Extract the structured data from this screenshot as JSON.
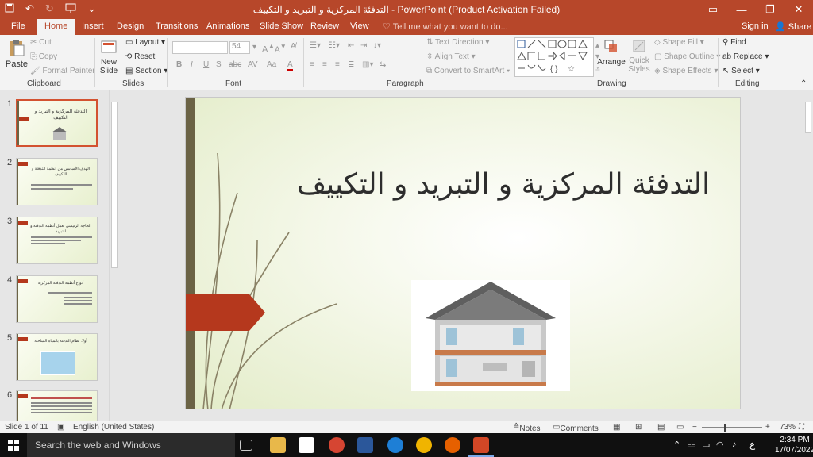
{
  "titlebar": {
    "title": "التدفئة المركزية و التبريد و التكييف - PowerPoint (Product Activation Failed)",
    "qat_icons": [
      "save-icon",
      "undo-icon",
      "redo-icon",
      "present-icon",
      "customize-icon"
    ],
    "restore_icon": "▭",
    "minimize_icon": "—",
    "maximize_icon": "❐",
    "close_icon": "✕"
  },
  "tabs": [
    "File",
    "Home",
    "Insert",
    "Design",
    "Transitions",
    "Animations",
    "Slide Show",
    "Review",
    "View"
  ],
  "tell_me": "Tell me what you want to do...",
  "sign_in": "Sign in",
  "share": "Share",
  "ribbon": {
    "clipboard": {
      "label": "Clipboard",
      "paste": "Paste",
      "cut": "Cut",
      "copy": "Copy",
      "format_painter": "Format Painter"
    },
    "slides": {
      "label": "Slides",
      "new_slide_1": "New",
      "new_slide_2": "Slide",
      "layout": "Layout",
      "reset": "Reset",
      "section": "Section"
    },
    "font": {
      "label": "Font",
      "size": "54",
      "buttons": [
        "B",
        "I",
        "U",
        "S",
        "abc",
        "AV",
        "Aa",
        "A"
      ]
    },
    "paragraph": {
      "label": "Paragraph",
      "text_direction": "Text Direction",
      "align_text": "Align Text",
      "convert_smartart": "Convert to SmartArt"
    },
    "drawing": {
      "label": "Drawing",
      "arrange": "Arrange",
      "quick_styles_1": "Quick",
      "quick_styles_2": "Styles",
      "shape_fill": "Shape Fill",
      "shape_outline": "Shape Outline",
      "shape_effects": "Shape Effects"
    },
    "editing": {
      "label": "Editing",
      "find": "Find",
      "replace": "Replace",
      "select": "Select"
    }
  },
  "thumbnails": [
    {
      "num": "1",
      "title": "التدفئة المركزية و التبريد و التكييف"
    },
    {
      "num": "2",
      "title": "الهدف الأساسي من أنظمة التدفئة و التكييف"
    },
    {
      "num": "3",
      "title": "الحاجة الرئيسي لعمل أنظمة التدفئة و التبريد"
    },
    {
      "num": "4",
      "title": "أنواع أنظمة التدفئة المركزية"
    },
    {
      "num": "5",
      "title": "أولا: نظام التدفئة بالمياه الساخنة"
    },
    {
      "num": "6",
      "title": ""
    }
  ],
  "slide": {
    "title": "التدفئة المركزية و التبريد و التكييف"
  },
  "status": {
    "slide_of": "Slide 1 of 11",
    "language": "English (United States)",
    "notes": "Notes",
    "comments": "Comments",
    "zoom": "73%"
  },
  "taskbar": {
    "search": "Search the web and Windows",
    "time": "2:34 PM",
    "date": "17/07/2022",
    "lang": "ع"
  },
  "colors": {
    "accent": "#b7472a",
    "slide_tag": "#b5381d",
    "slide_bar": "#6b6345"
  }
}
